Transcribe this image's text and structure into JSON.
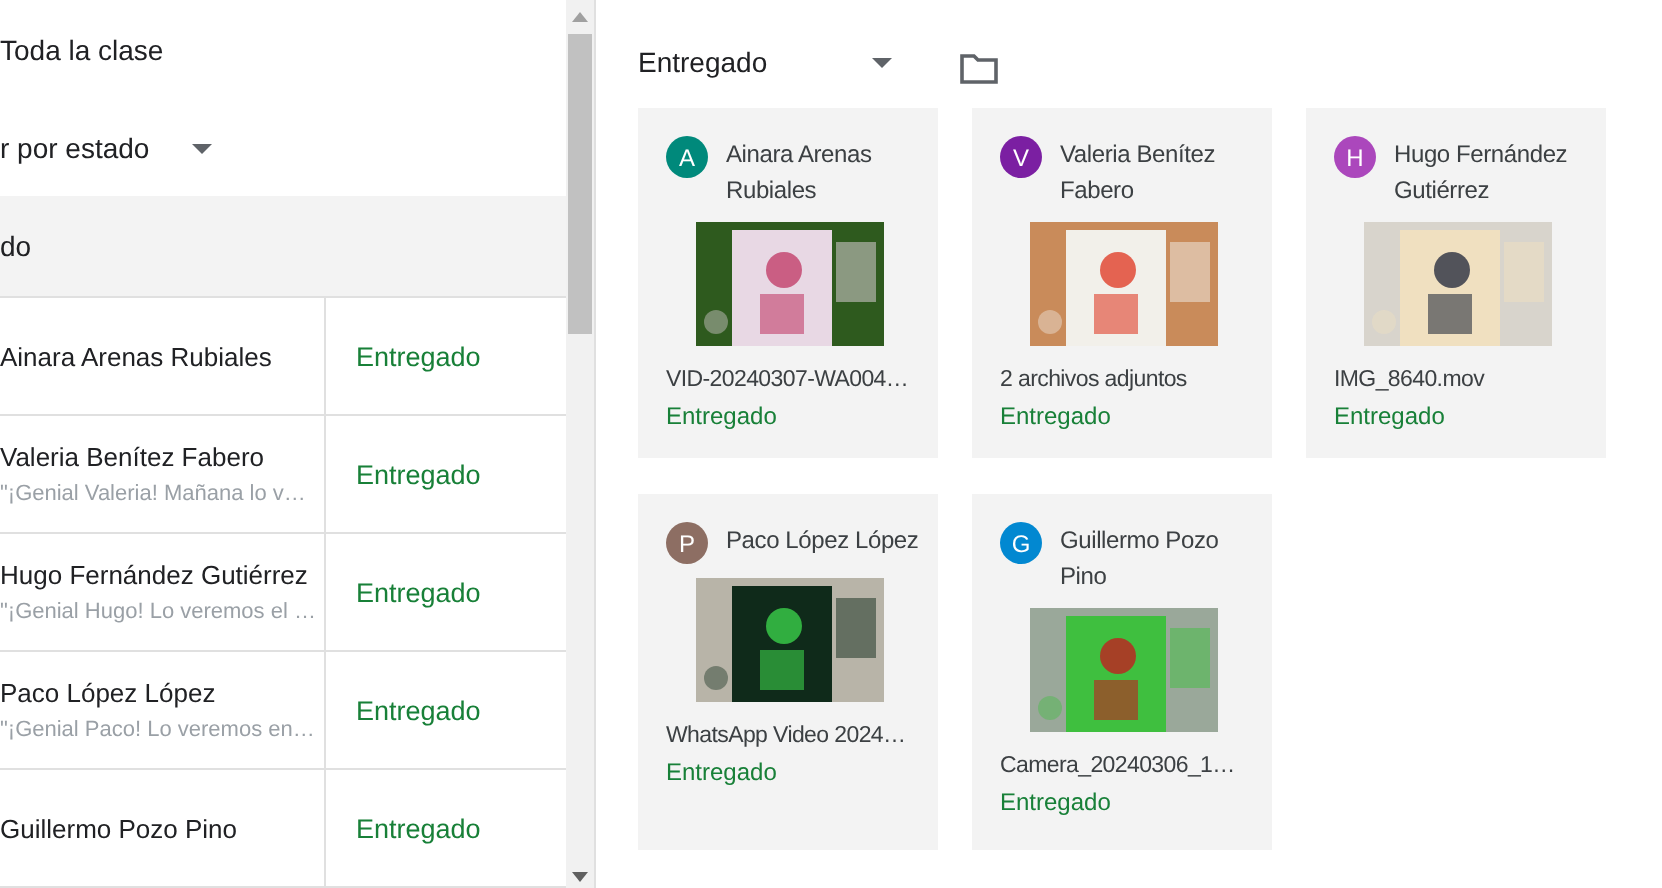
{
  "left_panel": {
    "audience": "Toda la clase",
    "sort_dropdown": "r por estado",
    "group_header": "do",
    "students": [
      {
        "name": "Ainara Arenas Rubiales",
        "status": "Entregado"
      },
      {
        "name": "Valeria Benítez Fabero",
        "comment": "\"¡Genial Valeria! Mañana lo v…",
        "status": "Entregado"
      },
      {
        "name": "Hugo Fernández Gutiérrez",
        "comment": "\"¡Genial Hugo! Lo veremos el …",
        "status": "Entregado"
      },
      {
        "name": "Paco López López",
        "comment": "\"¡Genial Paco! Lo veremos en…",
        "status": "Entregado"
      },
      {
        "name": "Guillermo Pozo Pino",
        "status": "Entregado"
      }
    ]
  },
  "right_panel": {
    "filter_dropdown": "Entregado",
    "submissions": [
      {
        "initial": "A",
        "color": "#00897b",
        "name": "Ainara Arenas Rubiales",
        "attachment": "VID-20240307-WA004…",
        "status": "Entregado"
      },
      {
        "initial": "V",
        "color": "#7b1fa2",
        "name": "Valeria Benítez Fabero",
        "attachment": "2 archivos adjuntos",
        "status": "Entregado"
      },
      {
        "initial": "H",
        "color": "#ab47bc",
        "name": "Hugo Fernández Gutiérrez",
        "attachment": "IMG_8640.mov",
        "status": "Entregado"
      },
      {
        "initial": "P",
        "color": "#8d6e63",
        "name": "Paco López López",
        "attachment": "WhatsApp Video 2024…",
        "status": "Entregado"
      },
      {
        "initial": "G",
        "color": "#0288d1",
        "name": "Guillermo Pozo Pino",
        "attachment": "Camera_20240306_1…",
        "status": "Entregado"
      }
    ]
  }
}
